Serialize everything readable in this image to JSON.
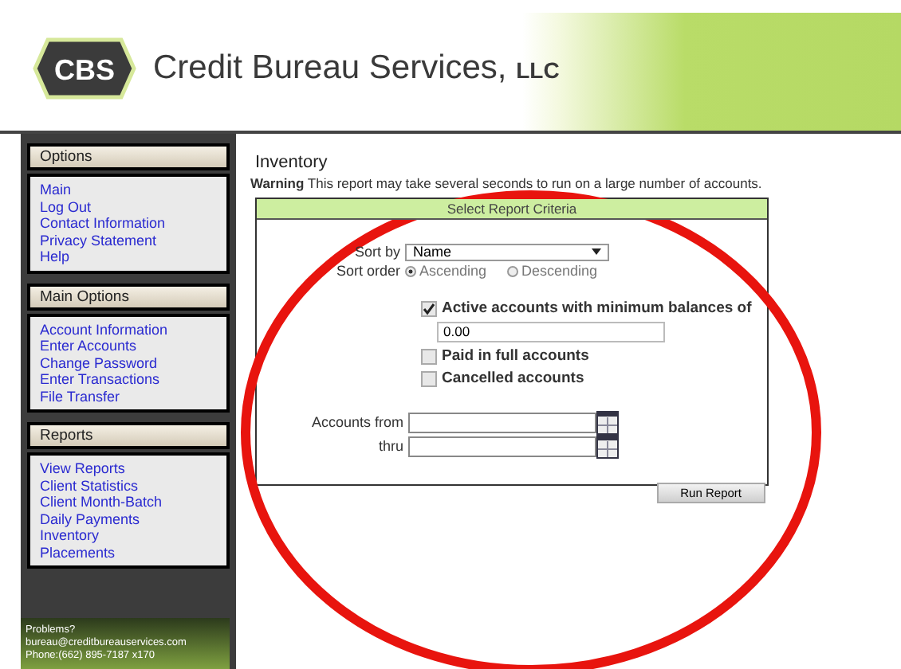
{
  "header": {
    "logo": "CBS",
    "company": "Credit Bureau Services,",
    "suffix": "LLC"
  },
  "sidebar": {
    "sections": [
      {
        "title": "Options",
        "items": [
          "Main",
          "Log Out",
          "Contact Information",
          "Privacy Statement",
          "Help"
        ]
      },
      {
        "title": "Main Options",
        "items": [
          "Account Information",
          "Enter Accounts",
          "Change Password",
          "Enter Transactions",
          "File Transfer"
        ]
      },
      {
        "title": "Reports",
        "items": [
          "View Reports",
          "Client Statistics",
          "Client Month-Batch",
          "Daily Payments",
          "Inventory",
          "Placements"
        ]
      }
    ],
    "footer": [
      "Problems?",
      "bureau@creditbureauservices.com",
      "Phone:(662) 895-7187 x170"
    ]
  },
  "page": {
    "title": "Inventory",
    "warning_label": "Warning",
    "warning_text": " This report may take several seconds to run on a large number of accounts."
  },
  "form": {
    "title": "Select Report Criteria",
    "sort_by": {
      "label": "Sort by",
      "value": "Name"
    },
    "sort_order": {
      "label": "Sort order",
      "options": [
        {
          "label": "Ascending",
          "selected": true
        },
        {
          "label": "Descending",
          "selected": false
        }
      ]
    },
    "checkboxes": [
      {
        "label": "Active accounts with minimum balances of",
        "checked": true,
        "value": "0.00"
      },
      {
        "label": "Paid in full accounts",
        "checked": false
      },
      {
        "label": "Cancelled accounts",
        "checked": false
      }
    ],
    "date_fields": [
      {
        "label": "Accounts from"
      },
      {
        "label": "thru"
      }
    ],
    "button": "Run Report"
  }
}
